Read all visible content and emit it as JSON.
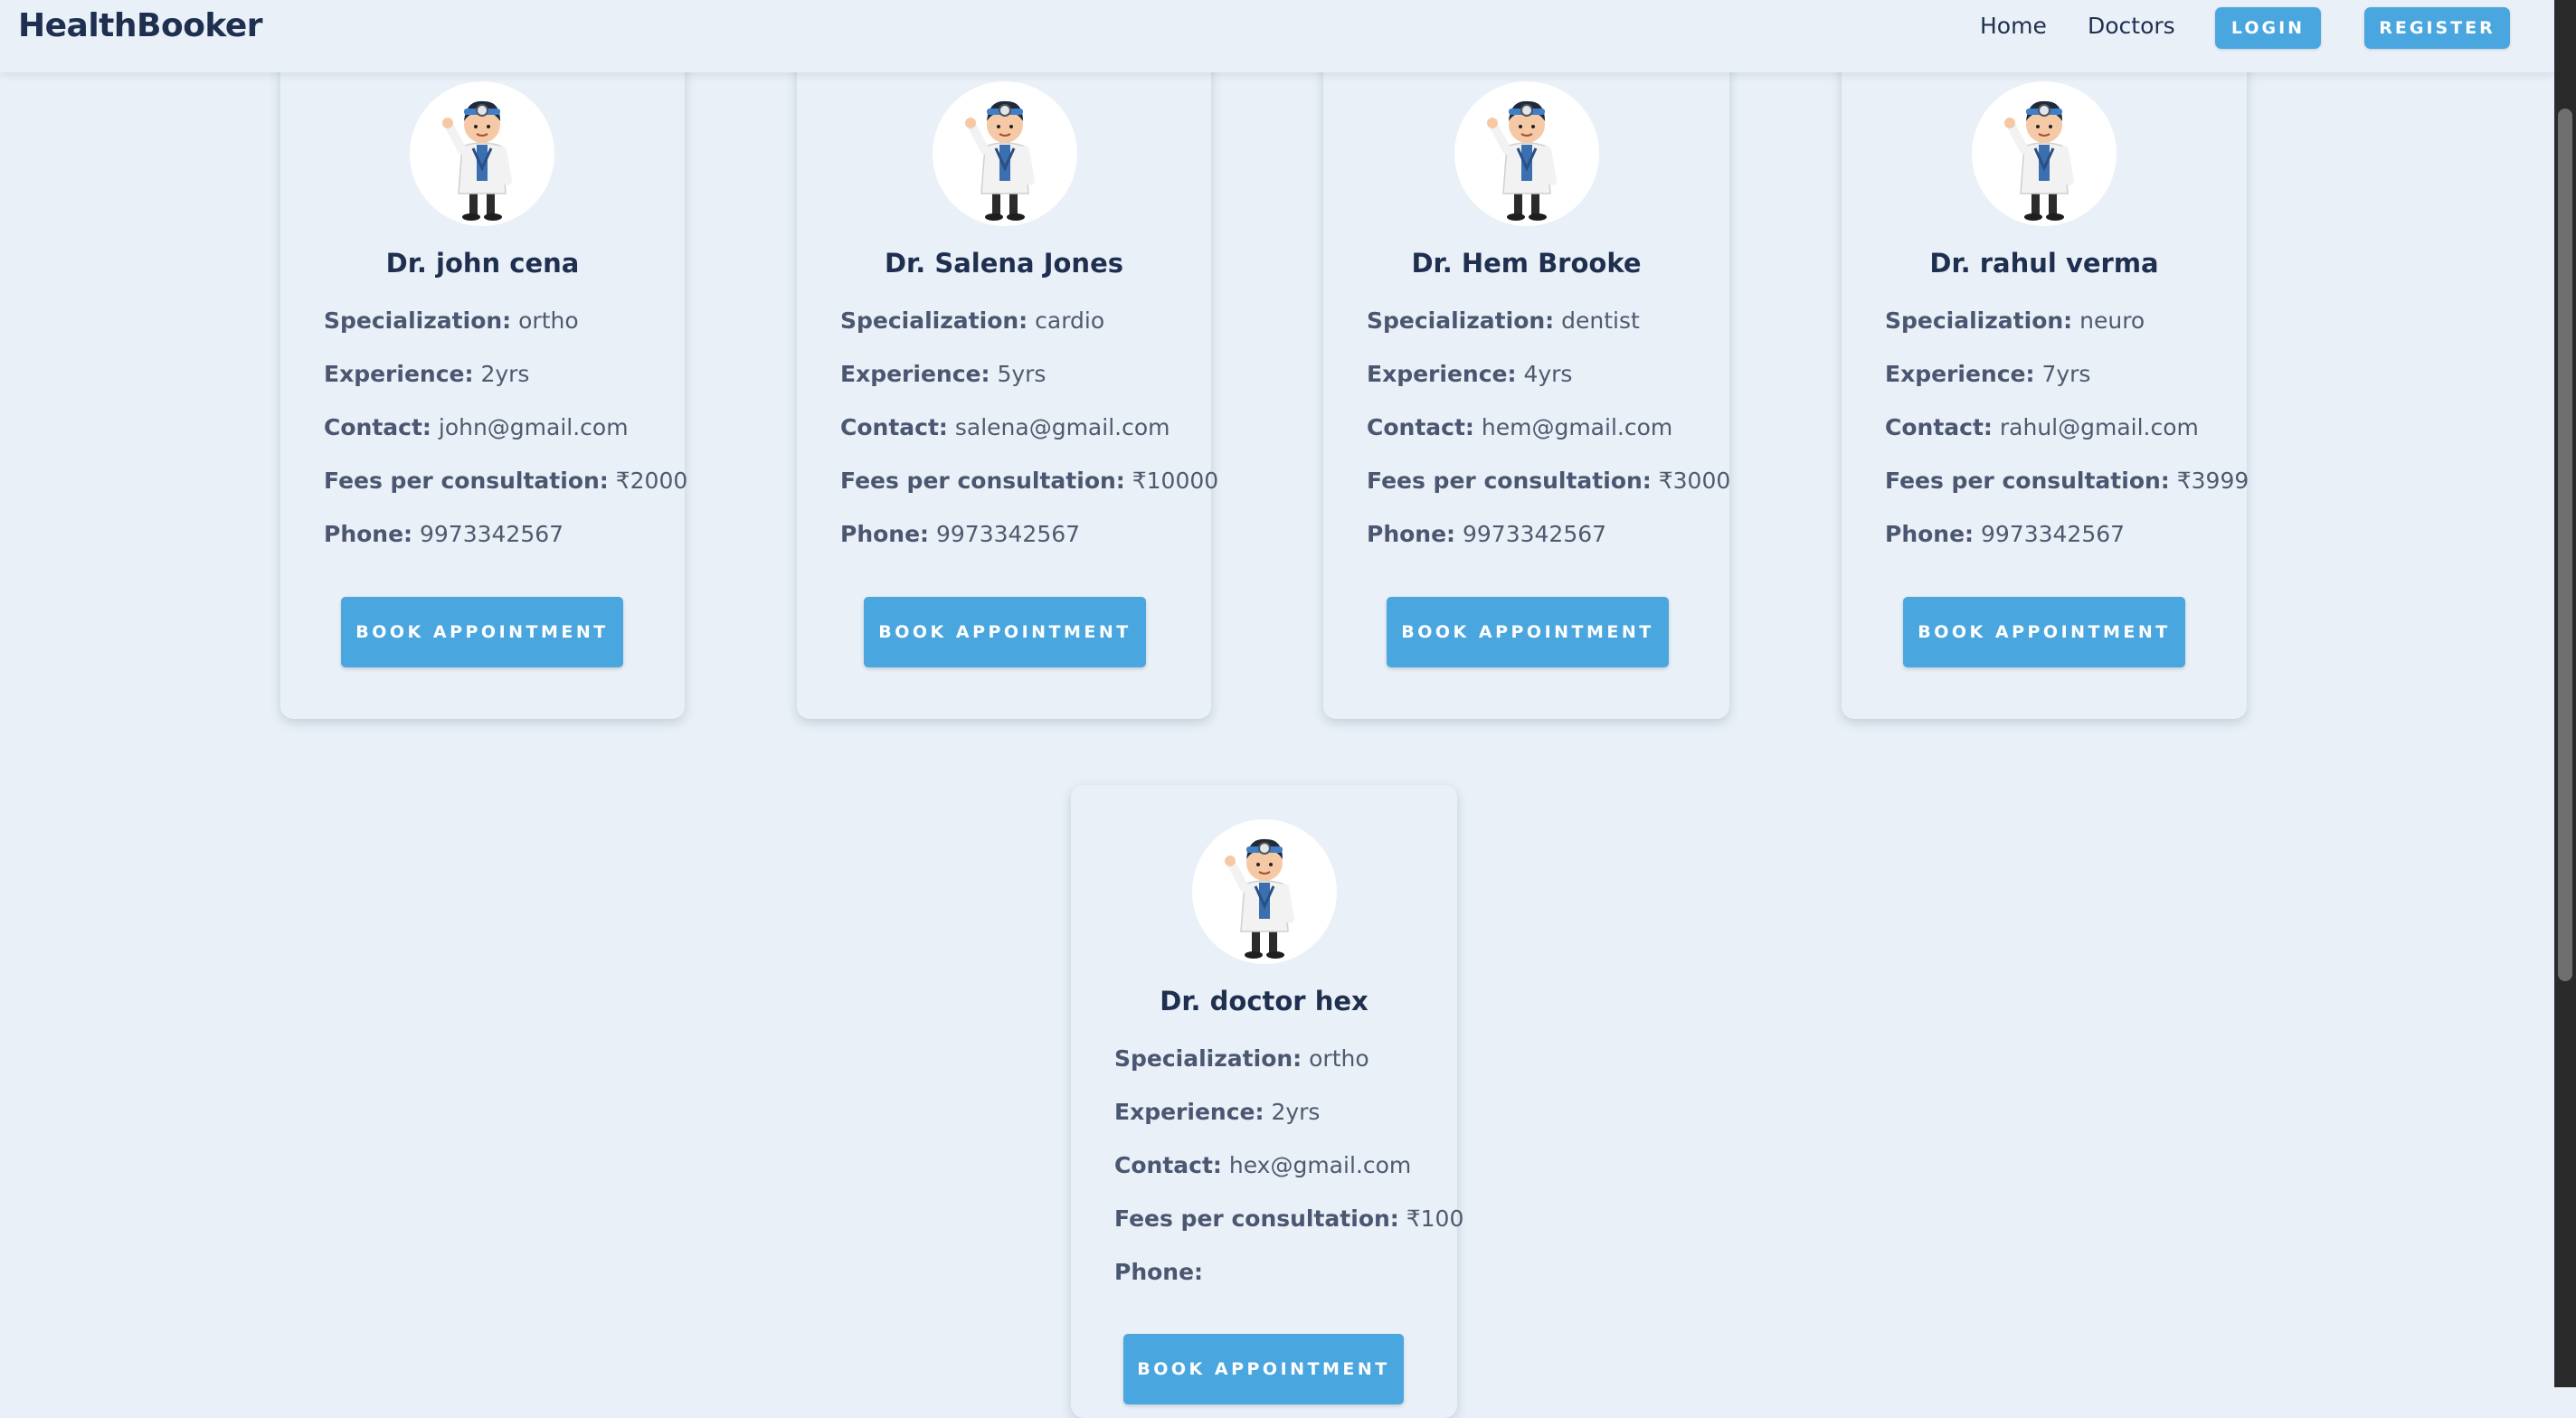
{
  "brand": "HealthBooker",
  "nav": {
    "home": "Home",
    "doctors": "Doctors",
    "login": "LOGIN",
    "register": "REGISTER"
  },
  "labels": {
    "specialization": "Specialization:",
    "experience": "Experience:",
    "contact": "Contact:",
    "fees": "Fees per consultation:",
    "phone": "Phone:",
    "book": "BOOK APPOINTMENT"
  },
  "avatar_icon": "doctor-avatar-icon",
  "colors": {
    "accent": "#4aa6de",
    "background": "#e9f0f8",
    "text": "#1f2f4f"
  },
  "doctors": [
    {
      "name": "Dr. john cena",
      "specialization": "ortho",
      "experience": "2yrs",
      "contact": "john@gmail.com",
      "fees": "₹2000",
      "phone": "9973342567"
    },
    {
      "name": "Dr. Salena Jones",
      "specialization": "cardio",
      "experience": "5yrs",
      "contact": "salena@gmail.com",
      "fees": "₹10000",
      "phone": "9973342567"
    },
    {
      "name": "Dr. Hem Brooke",
      "specialization": "dentist",
      "experience": "4yrs",
      "contact": "hem@gmail.com",
      "fees": "₹3000",
      "phone": "9973342567"
    },
    {
      "name": "Dr. rahul verma",
      "specialization": "neuro",
      "experience": "7yrs",
      "contact": "rahul@gmail.com",
      "fees": "₹3999",
      "phone": "9973342567"
    },
    {
      "name": "Dr. doctor hex",
      "specialization": "ortho",
      "experience": "2yrs",
      "contact": "hex@gmail.com",
      "fees": "₹100",
      "phone": ""
    }
  ]
}
